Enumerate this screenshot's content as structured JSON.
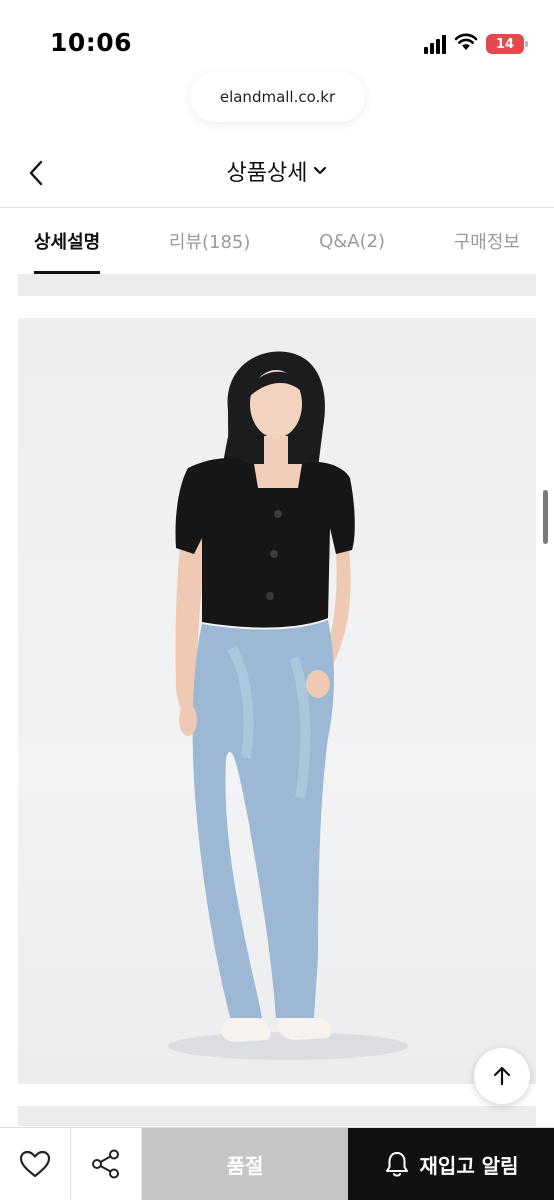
{
  "status_bar": {
    "time": "10:06",
    "battery": "14"
  },
  "browser": {
    "url": "elandmall.co.kr"
  },
  "header": {
    "title": "상품상세"
  },
  "tabs": [
    {
      "label": "상세설명",
      "active": true
    },
    {
      "label": "리뷰(185)",
      "active": false
    },
    {
      "label": "Q&A(2)",
      "active": false
    },
    {
      "label": "구매정보",
      "active": false
    }
  ],
  "bottom_bar": {
    "soldout_label": "품절",
    "restock_label": "재입고 알림"
  },
  "colors": {
    "accent": "#111111",
    "soldout": "#c6c6c6",
    "battery": "#e5484d"
  },
  "icons": [
    "chevron-left-icon",
    "chevron-down-icon",
    "heart-icon",
    "share-icon",
    "bell-icon",
    "arrow-up-icon",
    "wifi-icon",
    "signal-icon",
    "battery-icon"
  ]
}
